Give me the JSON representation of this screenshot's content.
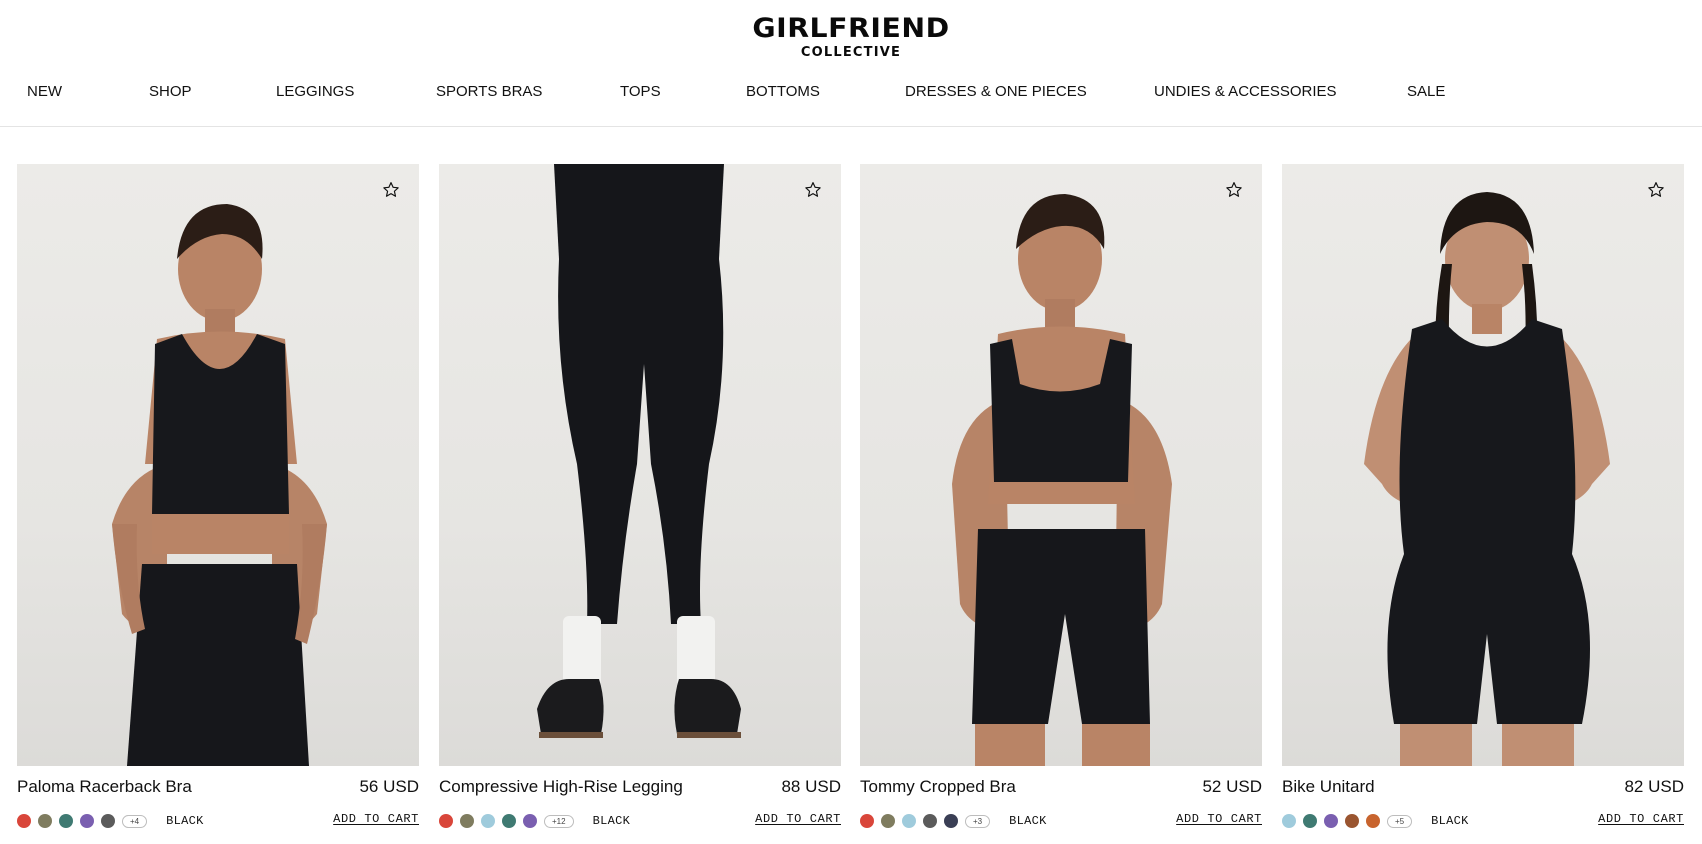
{
  "brand": {
    "line1": "GIRLFRIEND",
    "line2": "COLLECTIVE"
  },
  "nav": [
    {
      "label": "NEW"
    },
    {
      "label": "SHOP"
    },
    {
      "label": "LEGGINGS"
    },
    {
      "label": "SPORTS BRAS"
    },
    {
      "label": "TOPS"
    },
    {
      "label": "BOTTOMS"
    },
    {
      "label": "DRESSES & ONE PIECES"
    },
    {
      "label": "UNDIES & ACCESSORIES"
    },
    {
      "label": "SALE"
    }
  ],
  "products": [
    {
      "name": "Paloma Racerback Bra",
      "price": "56 USD",
      "swatches": [
        "#d9463a",
        "#7f7c5f",
        "#3f7a72",
        "#7a5fb0",
        "#5b5b5b"
      ],
      "more": "+4",
      "color": "BLACK",
      "cta": "ADD TO CART",
      "favorite_icon": "star-outline-icon",
      "image": "woman-in-black-racerback-bra-and-shorts"
    },
    {
      "name": "Compressive High-Rise Legging",
      "price": "88 USD",
      "swatches": [
        "#d9463a",
        "#7f7c5f",
        "#9fcbdc",
        "#3f7a72",
        "#7a5fb0"
      ],
      "more": "+12",
      "color": "BLACK",
      "cta": "ADD TO CART",
      "favorite_icon": "star-outline-icon",
      "image": "black-leggings-white-socks-black-sneakers"
    },
    {
      "name": "Tommy Cropped Bra",
      "price": "52 USD",
      "swatches": [
        "#d9463a",
        "#7f7c5f",
        "#9fcbdc",
        "#5b5b5b",
        "#3a3f55"
      ],
      "more": "+3",
      "color": "BLACK",
      "cta": "ADD TO CART",
      "favorite_icon": "star-outline-icon",
      "image": "woman-in-black-cropped-bra-and-bike-shorts"
    },
    {
      "name": "Bike Unitard",
      "price": "82 USD",
      "swatches": [
        "#9fcbdc",
        "#3f7a72",
        "#7a5fb0",
        "#9a5530",
        "#c8642e"
      ],
      "more": "+5",
      "color": "BLACK",
      "cta": "ADD TO CART",
      "favorite_icon": "star-outline-icon",
      "image": "woman-in-black-bike-unitard"
    }
  ]
}
